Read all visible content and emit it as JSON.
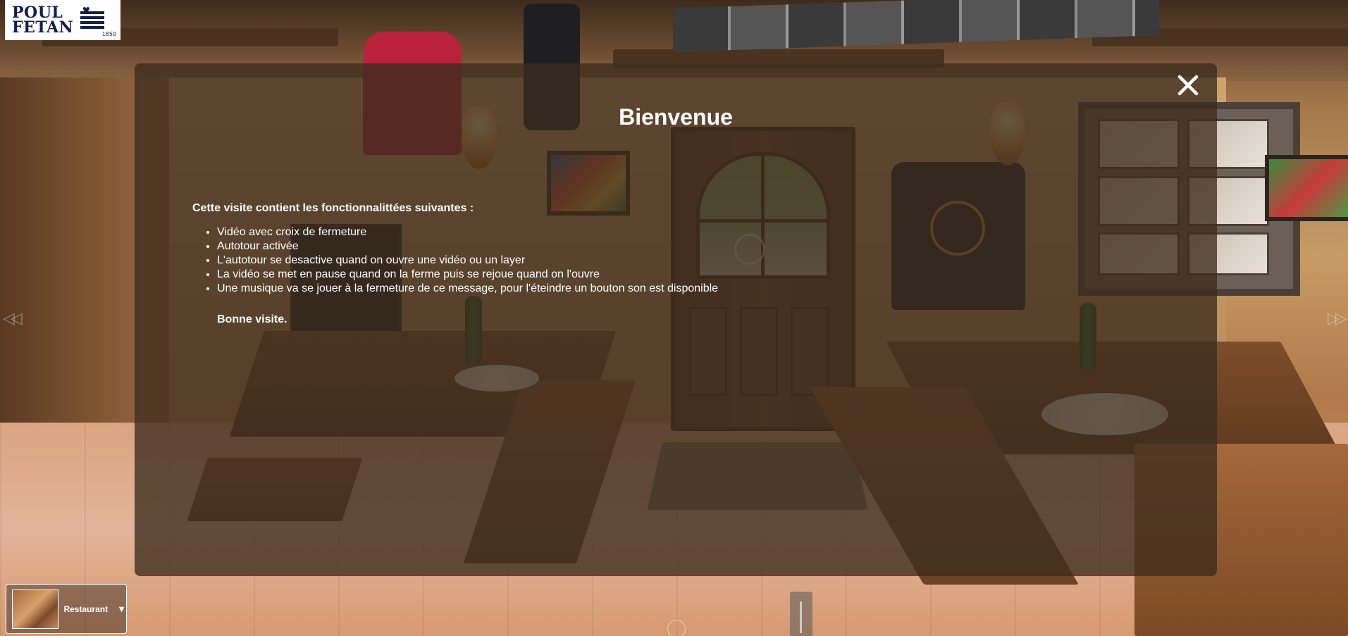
{
  "brand": {
    "logo_line1": "POUL",
    "logo_line2": "FETAN",
    "logo_year": "1850"
  },
  "modal": {
    "title": "Bienvenue",
    "intro": "Cette visite contient les fonctionnalittées suivantes :",
    "features": [
      "Vidéo avec croix de fermeture",
      "Autotour activée",
      "L'autotour se desactive quand on ouvre une vidéo ou un layer",
      "La vidéo se met en pause quand on la ferme puis se rejoue quand on l'ouvre",
      "Une musique va se jouer à la fermeture de ce message, pour l'éteindre un bouton son est disponible"
    ],
    "signoff": "Bonne visite.",
    "close_icon": "close-icon"
  },
  "navigation": {
    "prev_arrow": "◁◁",
    "next_arrow": "▷▷"
  },
  "scene_selector": {
    "current_scene": "Restaurant",
    "caret": "▼"
  },
  "colors": {
    "modal_overlay": "#3c2c1e",
    "text": "#ffffff",
    "logo_ink": "#14204a"
  }
}
